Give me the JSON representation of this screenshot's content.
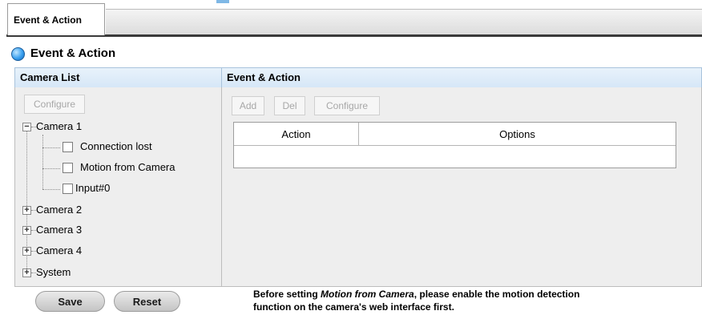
{
  "tabs": [
    {
      "label": "Event & Action",
      "active": true
    }
  ],
  "section": {
    "title": "Event & Action",
    "icon": "blue-orb-icon"
  },
  "camera_panel": {
    "header": "Camera List",
    "configure_label": "Configure",
    "tree": {
      "camera1": {
        "label": "Camera 1",
        "expanded": true,
        "children": [
          {
            "label": "Connection lost",
            "checked": false
          },
          {
            "label": "Motion from Camera",
            "checked": false
          },
          {
            "label": "Input#0",
            "checked": false
          }
        ]
      },
      "camera2": {
        "label": "Camera 2",
        "expanded": false
      },
      "camera3": {
        "label": "Camera 3",
        "expanded": false
      },
      "camera4": {
        "label": "Camera 4",
        "expanded": false
      },
      "system": {
        "label": "System",
        "expanded": false
      }
    }
  },
  "event_panel": {
    "header": "Event & Action",
    "add_label": "Add",
    "del_label": "Del",
    "configure_label": "Configure",
    "table": {
      "columns": [
        "Action",
        "Options"
      ],
      "rows": []
    }
  },
  "footer": {
    "save_label": "Save",
    "reset_label": "Reset",
    "note_prefix": "Before setting ",
    "note_emphasis": "Motion from Camera",
    "note_line1_suffix": ", please enable the motion detection",
    "note_line2": "function on the camera's web interface first."
  },
  "colors": {
    "panel_header": "#d6e7f7",
    "panel_body": "#eeeeee",
    "tab_underline": "#3a3a3a"
  }
}
